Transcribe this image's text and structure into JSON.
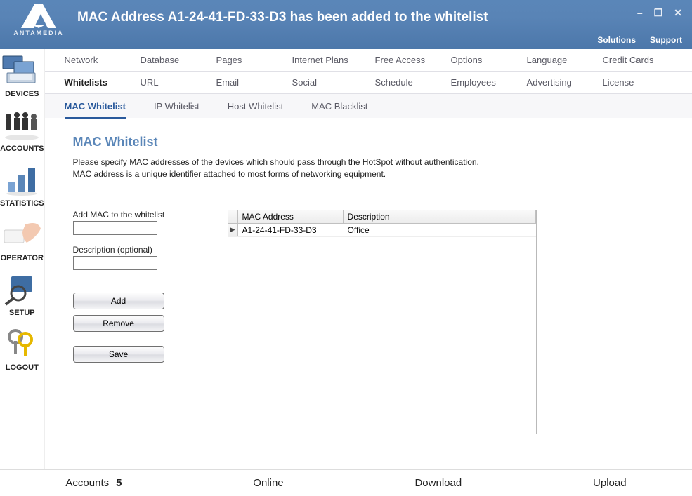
{
  "header": {
    "brand": "ANTAMEDIA",
    "title": "MAC Address A1-24-41-FD-33-D3 has been added to the whitelist",
    "links": {
      "solutions": "Solutions",
      "support": "Support"
    }
  },
  "sidebar": [
    {
      "id": "devices",
      "label": "DEVICES"
    },
    {
      "id": "accounts",
      "label": "ACCOUNTS"
    },
    {
      "id": "statistics",
      "label": "STATISTICS"
    },
    {
      "id": "operator",
      "label": "OPERATOR"
    },
    {
      "id": "setup",
      "label": "SETUP"
    },
    {
      "id": "logout",
      "label": "LOGOUT"
    }
  ],
  "tabs": {
    "row1": [
      "Network",
      "Database",
      "Pages",
      "Internet Plans",
      "Free Access",
      "Options",
      "Language",
      "Credit Cards"
    ],
    "row2": [
      "Whitelists",
      "URL",
      "Email",
      "Social",
      "Schedule",
      "Employees",
      "Advertising",
      "License"
    ],
    "row2_active": "Whitelists",
    "row3": [
      "MAC Whitelist",
      "IP Whitelist",
      "Host Whitelist",
      "MAC Blacklist"
    ],
    "row3_active": "MAC Whitelist"
  },
  "section": {
    "title": "MAC Whitelist",
    "desc_line1": "Please specify MAC addresses of the devices which should pass through the HotSpot without authentication.",
    "desc_line2": "MAC address is a unique identifier attached to most forms of networking equipment."
  },
  "form": {
    "add_label": "Add MAC to the whitelist",
    "desc_label": "Description (optional)",
    "mac_value": "",
    "desc_value": "",
    "buttons": {
      "add": "Add",
      "remove": "Remove",
      "save": "Save"
    }
  },
  "grid": {
    "col_mac": "MAC Address",
    "col_desc": "Description",
    "rows": [
      {
        "mac": "A1-24-41-FD-33-D3",
        "desc": "Office"
      }
    ]
  },
  "status": {
    "accounts_label": "Accounts",
    "accounts_value": "5",
    "online": "Online",
    "download": "Download",
    "upload": "Upload"
  }
}
